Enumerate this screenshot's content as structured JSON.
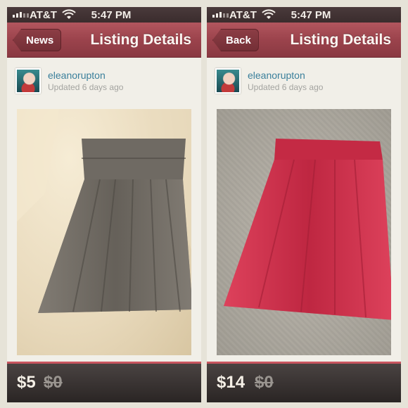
{
  "status": {
    "carrier": "AT&T",
    "time": "5:47 PM"
  },
  "panels": [
    {
      "nav_back_label": "News",
      "title": "Listing Details",
      "username": "eleanorupton",
      "updated": "Updated 6 days ago",
      "item_color": "#6f6a63",
      "price": "$5",
      "original_price": "$0"
    },
    {
      "nav_back_label": "Back",
      "title": "Listing Details",
      "username": "eleanorupton",
      "updated": "Updated 6 days ago",
      "item_color": "#d0304a",
      "price": "$14",
      "original_price": "$0"
    }
  ],
  "colors": {
    "nav_bar": "#9b434c",
    "username": "#3a7f9b",
    "accent": "#c9555f"
  }
}
